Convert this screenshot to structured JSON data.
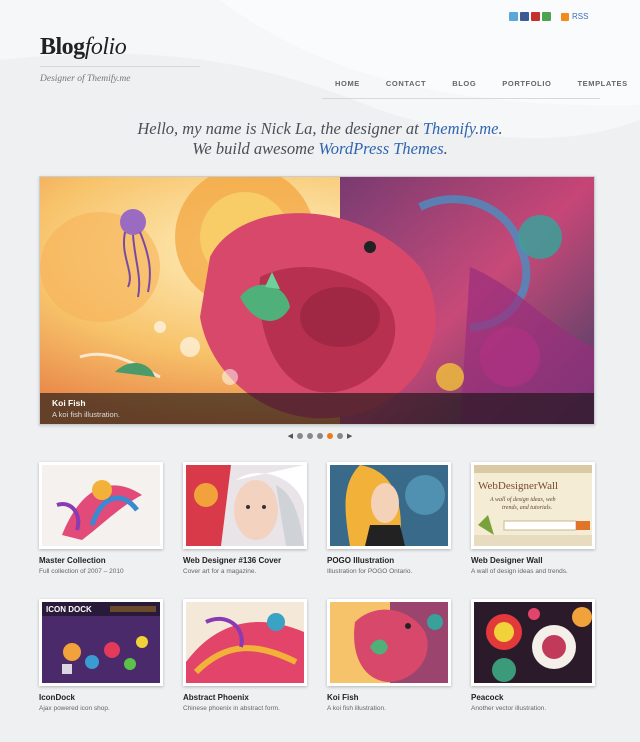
{
  "header": {
    "logo_bold": "Blog",
    "logo_italic": "folio",
    "tagline": "Designer of Themify.me",
    "rss_label": "RSS",
    "social_icons": [
      "twitter-icon",
      "facebook-icon",
      "youtube-icon",
      "delicious-icon"
    ],
    "social_colors": [
      "#5aa7d8",
      "#3b5a98",
      "#c4302b",
      "#4ea34e"
    ]
  },
  "nav": {
    "items": [
      "HOME",
      "CONTACT",
      "BLOG",
      "PORTFOLIO",
      "TEMPLATES"
    ]
  },
  "intro": {
    "line1_pre": "Hello, my name is Nick La, the designer at ",
    "line1_link": "Themify.me",
    "line1_post": ".",
    "line2_pre": "We build awesome ",
    "line2_link": "WordPress Themes",
    "line2_post": "."
  },
  "slider": {
    "title": "Koi Fish",
    "description": "A koi fish illustration.",
    "active_index": 3,
    "dot_count": 5,
    "prev_icon": "chevron-left-icon",
    "next_icon": "chevron-right-icon"
  },
  "portfolio": [
    {
      "title": "Master Collection",
      "desc": "Full collection of 2007 – 2010"
    },
    {
      "title": "Web Designer #136 Cover",
      "desc": "Cover art for a magazine."
    },
    {
      "title": "POGO Illustration",
      "desc": "Illustration for POGO Ontario."
    },
    {
      "title": "Web Designer Wall",
      "desc": "A wall of design ideas and trends."
    },
    {
      "title": "IconDock",
      "desc": "Ajax powered icon shop."
    },
    {
      "title": "Abstract Phoenix",
      "desc": "Chinese phoenix in abstract form."
    },
    {
      "title": "Koi Fish",
      "desc": "A koi fish illustration."
    },
    {
      "title": "Peacock",
      "desc": "Another vector illustration."
    }
  ],
  "thumb_text": {
    "wdw_title": "WebDesignerWall",
    "wdw_sub1": "A wall of design ideas, web",
    "wdw_sub2": "trends, and tutorials.",
    "icondock": "ICON DOCK"
  },
  "colors": {
    "accent": "#2f64b0",
    "pager_active": "#f07a1a"
  }
}
